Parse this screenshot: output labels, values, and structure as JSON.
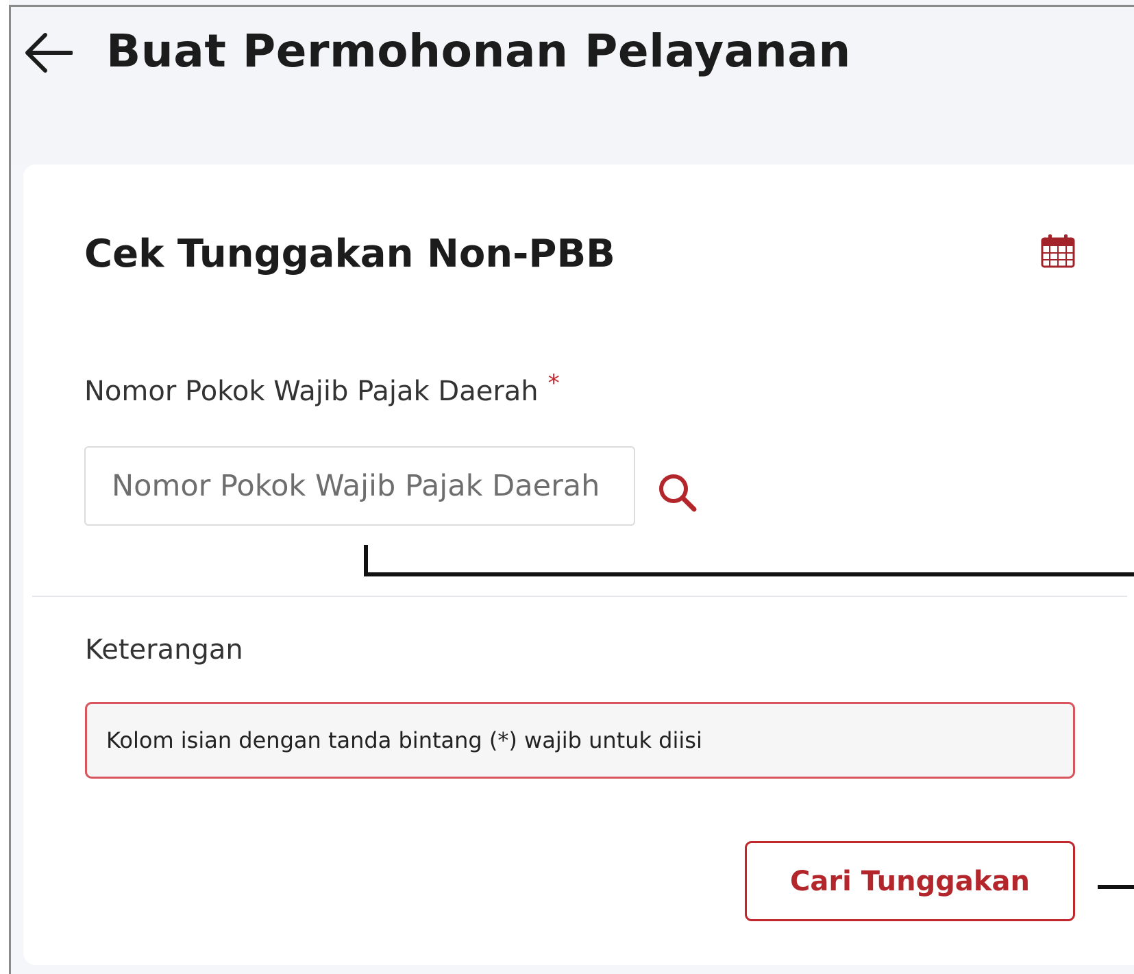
{
  "header": {
    "back_icon": "arrow-left-icon",
    "title": "Buat Permohonan Pelayanan"
  },
  "card": {
    "title": "Cek Tunggakan Non-PBB",
    "calendar_icon": "calendar-icon",
    "npwpd": {
      "label": "Nomor Pokok Wajib Pajak Daerah",
      "required_mark": "*",
      "placeholder": "Nomor Pokok Wajib Pajak Daerah",
      "value": "",
      "search_icon": "search-icon"
    },
    "keterangan": {
      "label": "Keterangan",
      "notice": "Kolom isian dengan tanda bintang (*) wajib untuk diisi"
    },
    "submit_label": "Cari Tunggakan"
  },
  "colors": {
    "accent": "#c0282d",
    "notice_border": "#d9555e",
    "background": "#f4f6fa"
  }
}
